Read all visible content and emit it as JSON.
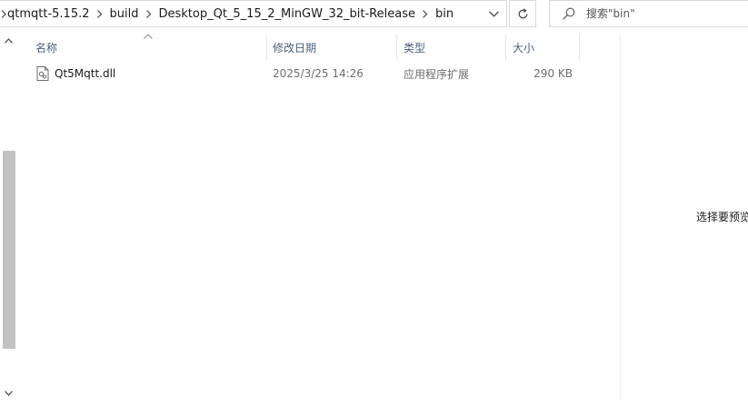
{
  "address_bar": {
    "crumbs": [
      "qtmqtt-5.15.2",
      "build",
      "Desktop_Qt_5_15_2_MinGW_32_bit-Release",
      "bin"
    ]
  },
  "search": {
    "placeholder": "搜索\"bin\""
  },
  "columns": {
    "name": "名称",
    "date": "修改日期",
    "type": "类型",
    "size": "大小"
  },
  "files": [
    {
      "name": "Qt5Mqtt.dll",
      "date": "2025/3/25 14:26",
      "type": "应用程序扩展",
      "size": "290 KB",
      "icon": "dll-file-icon"
    }
  ],
  "preview": {
    "text": "选择要预览"
  },
  "colors": {
    "header_text": "#4c607a",
    "meta_text": "#6d6d6d",
    "scroll_thumb": "#c2c2c2",
    "border": "#d9d9d9"
  }
}
